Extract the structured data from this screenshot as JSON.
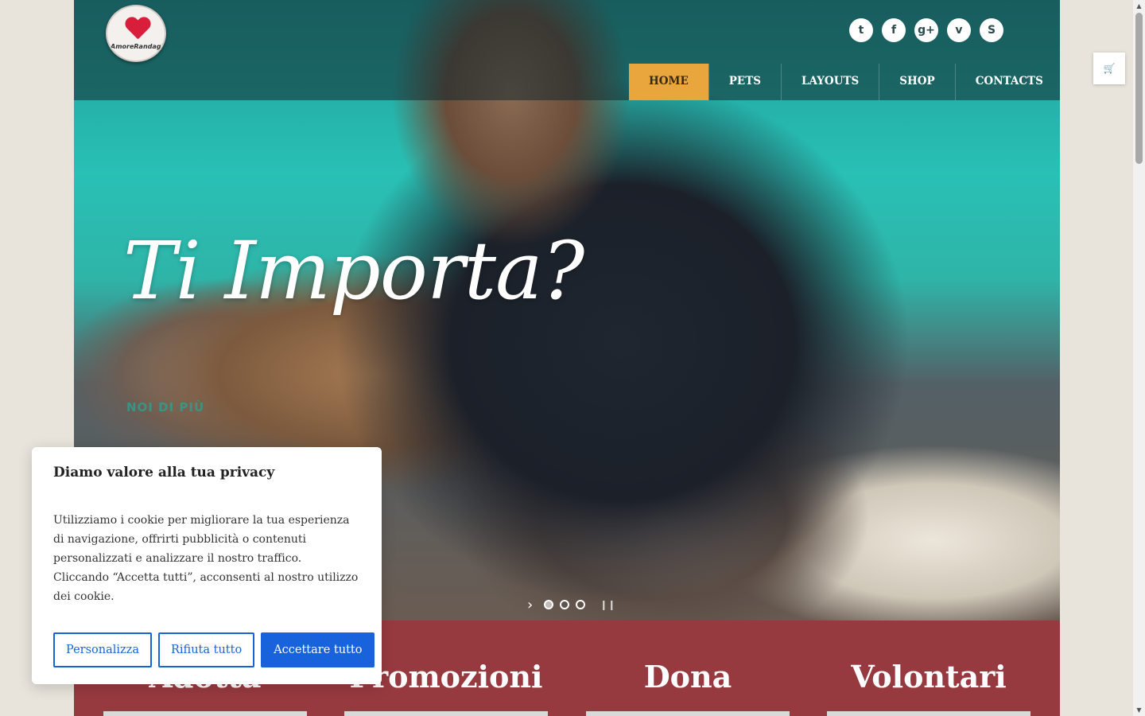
{
  "brand": {
    "logo_text": "AmoreRandagio"
  },
  "social": [
    {
      "name": "twitter",
      "glyph": "t"
    },
    {
      "name": "facebook",
      "glyph": "f"
    },
    {
      "name": "google-plus",
      "glyph": "g+"
    },
    {
      "name": "vimeo",
      "glyph": "v"
    },
    {
      "name": "skype",
      "glyph": "S"
    }
  ],
  "nav": {
    "items": [
      "HOME",
      "PETS",
      "LAYOUTS",
      "SHOP",
      "CONTACTS"
    ],
    "active": "HOME"
  },
  "cart": {
    "icon": "cart-icon",
    "glyph": "🛒"
  },
  "hero": {
    "title": "Ti Importa?",
    "caption": "NOI DI PIÙ",
    "slider": {
      "slides": 3,
      "current": 1
    }
  },
  "features": [
    "Adotta",
    "Promozioni",
    "Dona",
    "Volontari"
  ],
  "cookie": {
    "title": "Diamo valore alla tua privacy",
    "text": "Utilizziamo i cookie per migliorare la tua esperienza di navigazione, offrirti pubblicità o contenuti personalizzati e analizzare il nostro traffico. Cliccando “Accetta tutti”, acconsenti al nostro utilizzo dei cookie.",
    "btn_customize": "Personalizza",
    "btn_reject": "Rifiuta tutto",
    "btn_accept": "Accettare tutto"
  },
  "colors": {
    "accent": "#e8a63c",
    "band": "#973a40",
    "cookie_button": "#1863dc"
  }
}
